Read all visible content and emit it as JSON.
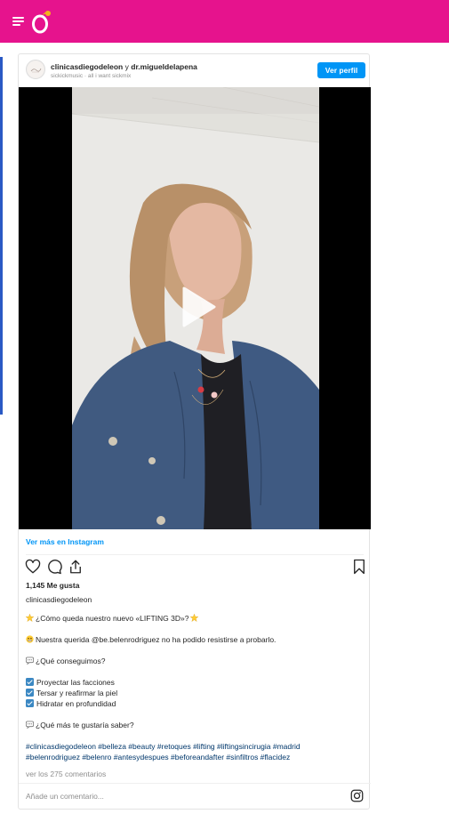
{
  "site": {
    "logo_letter": "Ó",
    "brand_color": "#e6138d"
  },
  "post": {
    "author": "clinicasdiegodeleon",
    "connector": "y",
    "coauthor": "dr.migueldelapena",
    "audio": "sickickmusic · all i want sickmix",
    "view_profile": "Ver perfil",
    "view_more": "Ver más en Instagram",
    "likes": "1,145 Me gusta",
    "owner": "clinicasdiegodeleon",
    "caption": {
      "line1": "¿Cómo queda nuestro nuevo «LIFTING 3D»?",
      "line2": "Nuestra querida @be.belenrodriguez no ha podido resistirse a probarlo.",
      "line3": "¿Qué conseguimos?",
      "check1": "Proyectar las facciones",
      "check2": "Tersar y reafirmar la piel",
      "check3": "Hidratar en profundidad",
      "line4": "¿Qué más te gustaría saber?",
      "tags1": "#clinicasdiegodeleon #belleza #beauty #retoques #lifting #liftingsincirugia #madrid",
      "tags2": "#belenrodriguez #belenro #antesydespues #beforeandafter #sinfiltros #flacidez"
    },
    "comments_link": "ver los 275 comentarios",
    "comment_placeholder": "Añade un comentario..."
  },
  "icons": {
    "menu": "menu-icon",
    "play": "play-icon",
    "like": "heart-icon",
    "comment": "comment-icon",
    "share": "share-icon",
    "save": "bookmark-icon",
    "instagram": "instagram-icon"
  }
}
